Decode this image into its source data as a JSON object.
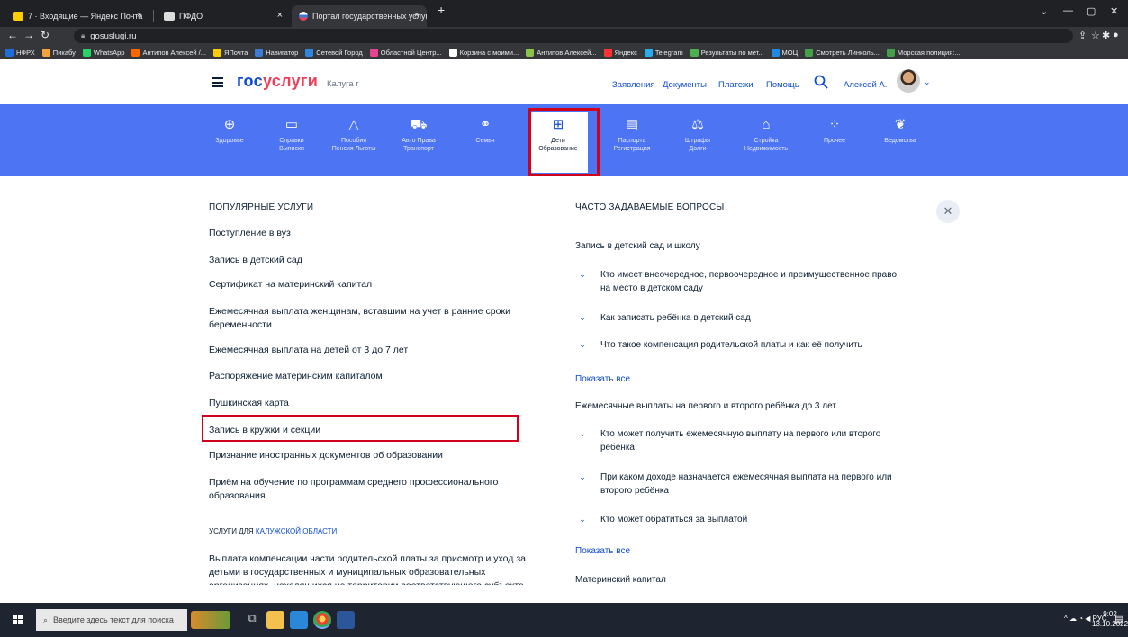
{
  "browser": {
    "tabs": [
      {
        "title": "7 · Входящие — Яндекс Почта",
        "color": "#ffcc00"
      },
      {
        "title": "ПФДО",
        "color": "#dddddd"
      },
      {
        "title": "Портал государственных услуг",
        "color": "#3c7bd4"
      }
    ],
    "new_tab": "+",
    "url": "gosuslugi.ru",
    "bookmarks": [
      {
        "label": "НФРХ",
        "color": "#1e6fd9"
      },
      {
        "label": "Пикабу",
        "color": "#f6a23a"
      },
      {
        "label": "WhatsApp",
        "color": "#25d366"
      },
      {
        "label": "Антипов Алексей /...",
        "color": "#ff6600"
      },
      {
        "label": "ЯПочта",
        "color": "#ffcc00"
      },
      {
        "label": "Навигатор",
        "color": "#3c7bd4"
      },
      {
        "label": "Сетевой Город",
        "color": "#2e86de"
      },
      {
        "label": "Областной Центр...",
        "color": "#e84393"
      },
      {
        "label": "Корзина с моими...",
        "color": "#ffffff"
      },
      {
        "label": "Антипов Алексей...",
        "color": "#8bc34a"
      },
      {
        "label": "Яндекс",
        "color": "#ff3333"
      },
      {
        "label": "Telegram",
        "color": "#2aabee"
      },
      {
        "label": "Результаты по мет...",
        "color": "#4caf50"
      },
      {
        "label": "МОЦ",
        "color": "#1e88e5"
      },
      {
        "label": "Смотреть Линколь...",
        "color": "#43a047"
      },
      {
        "label": "Морская полиция:...",
        "color": "#43a047"
      }
    ]
  },
  "header": {
    "logo_part1": "гос",
    "logo_part2": "услуги",
    "region": "Калуга г",
    "links": [
      "Заявления",
      "Документы",
      "Платежи",
      "Помощь"
    ],
    "user": "Алексей А."
  },
  "categories": [
    {
      "icon": "⊕",
      "label1": "Здоровье",
      "label2": ""
    },
    {
      "icon": "▭",
      "label1": "Справки",
      "label2": "Выписки"
    },
    {
      "icon": "△",
      "label1": "Пособия",
      "label2": "Пенсия Льготы"
    },
    {
      "icon": "⛟",
      "label1": "Авто Права",
      "label2": "Транспорт"
    },
    {
      "icon": "⚭",
      "label1": "Семья",
      "label2": ""
    },
    {
      "icon": "⊞",
      "label1": "Дети",
      "label2": "Образование"
    },
    {
      "icon": "▤",
      "label1": "Паспорта",
      "label2": "Регистрация"
    },
    {
      "icon": "⚖",
      "label1": "Штрафы",
      "label2": "Долги"
    },
    {
      "icon": "⌂",
      "label1": "Стройка",
      "label2": "Недвижимость"
    },
    {
      "icon": "⁘",
      "label1": "Прочее",
      "label2": ""
    },
    {
      "icon": "❦",
      "label1": "Ведомства",
      "label2": ""
    }
  ],
  "popular": {
    "heading": "ПОПУЛЯРНЫЕ УСЛУГИ",
    "items": [
      "Поступление в вуз",
      "Запись в детский сад",
      "Сертификат на материнский капитал",
      "Ежемесячная выплата женщинам, вставшим на учет в ранние сроки беременности",
      "Ежемесячная выплата на детей от 3 до 7 лет",
      "Распоряжение материнским капиталом",
      "Пушкинская карта",
      "Запись в кружки и секции",
      "Признание иностранных документов об образовании",
      "Приём на обучение по программам среднего профессионального образования"
    ],
    "region_prefix": "УСЛУГИ ДЛЯ ",
    "region_link": "КАЛУЖСКОЙ ОБЛАСТИ",
    "region_item": "Выплата компенсации части родительской платы за присмотр и уход за детьми в государственных и муниципальных образовательных организациях, находящихся на территории соответствующего субъекта"
  },
  "faq": {
    "heading": "ЧАСТО ЗАДАВАЕМЫЕ ВОПРОСЫ",
    "group1": "Запись в детский сад и школу",
    "g1_items": [
      "Кто имеет внеочередное, первоочередное и преимущественное право на место в детском саду",
      "Как записать ребёнка в детский сад",
      "Что такое компенсация родительской платы и как её получить"
    ],
    "show_all": "Показать все",
    "group2": "Ежемесячные выплаты на первого и второго ребёнка до 3 лет",
    "g2_items": [
      "Кто может получить ежемесячную выплату на первого или второго ребёнка",
      "При каком доходе назначается ежемесячная выплата на первого или второго ребёнка",
      "Кто может обратиться за выплатой"
    ],
    "group3": "Материнский капитал"
  },
  "taskbar": {
    "search_placeholder": "Введите здесь текст для поиска",
    "lang": "РУС",
    "time": "9:02",
    "date": "13.10.2022"
  }
}
